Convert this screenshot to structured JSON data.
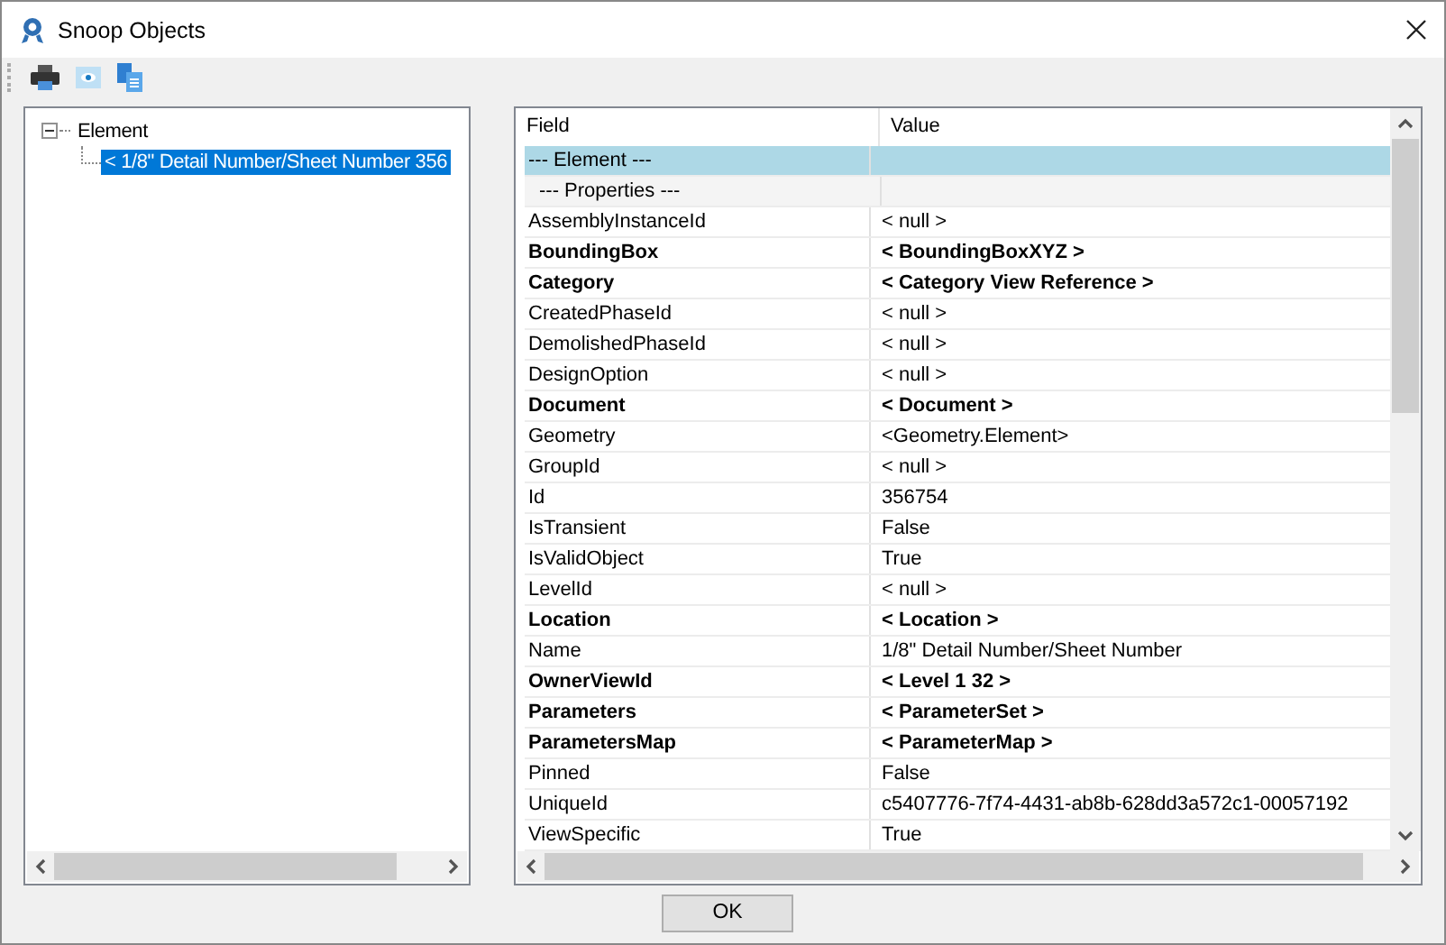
{
  "window": {
    "title": "Snoop Objects"
  },
  "toolbar": [
    {
      "kind": "print"
    },
    {
      "kind": "view"
    },
    {
      "kind": "copy"
    }
  ],
  "tree": {
    "items": [
      {
        "label": "Element",
        "expanded": true,
        "selected": false,
        "children": [
          {
            "label": "< 1/8\" Detail Number/Sheet Number  356",
            "selected": true
          }
        ]
      }
    ]
  },
  "table": {
    "columns": [
      "Field",
      "Value"
    ],
    "rows": [
      {
        "kind": "group",
        "field": "--- Element ---",
        "value": "",
        "selected": true,
        "bold": false
      },
      {
        "kind": "section",
        "field": "--- Properties ---",
        "value": "",
        "selected": false,
        "bold": false
      },
      {
        "kind": "item",
        "field": "AssemblyInstanceId",
        "value": "< null >",
        "selected": false,
        "bold": false
      },
      {
        "kind": "item",
        "field": "BoundingBox",
        "value": "< BoundingBoxXYZ >",
        "selected": false,
        "bold": true
      },
      {
        "kind": "item",
        "field": "Category",
        "value": "< Category  View Reference >",
        "selected": false,
        "bold": true
      },
      {
        "kind": "item",
        "field": "CreatedPhaseId",
        "value": "< null >",
        "selected": false,
        "bold": false
      },
      {
        "kind": "item",
        "field": "DemolishedPhaseId",
        "value": "< null >",
        "selected": false,
        "bold": false
      },
      {
        "kind": "item",
        "field": "DesignOption",
        "value": "< null >",
        "selected": false,
        "bold": false
      },
      {
        "kind": "item",
        "field": "Document",
        "value": "< Document >",
        "selected": false,
        "bold": true
      },
      {
        "kind": "item",
        "field": "Geometry",
        "value": "<Geometry.Element>",
        "selected": false,
        "bold": false
      },
      {
        "kind": "item",
        "field": "GroupId",
        "value": "< null >",
        "selected": false,
        "bold": false
      },
      {
        "kind": "item",
        "field": "Id",
        "value": "356754",
        "selected": false,
        "bold": false
      },
      {
        "kind": "item",
        "field": "IsTransient",
        "value": "False",
        "selected": false,
        "bold": false
      },
      {
        "kind": "item",
        "field": "IsValidObject",
        "value": "True",
        "selected": false,
        "bold": false
      },
      {
        "kind": "item",
        "field": "LevelId",
        "value": "< null >",
        "selected": false,
        "bold": false
      },
      {
        "kind": "item",
        "field": "Location",
        "value": "< Location >",
        "selected": false,
        "bold": true
      },
      {
        "kind": "item",
        "field": "Name",
        "value": "1/8\" Detail Number/Sheet Number",
        "selected": false,
        "bold": false
      },
      {
        "kind": "item",
        "field": "OwnerViewId",
        "value": "< Level 1  32 >",
        "selected": false,
        "bold": true
      },
      {
        "kind": "item",
        "field": "Parameters",
        "value": "< ParameterSet >",
        "selected": false,
        "bold": true
      },
      {
        "kind": "item",
        "field": "ParametersMap",
        "value": "< ParameterMap >",
        "selected": false,
        "bold": true
      },
      {
        "kind": "item",
        "field": "Pinned",
        "value": "False",
        "selected": false,
        "bold": false
      },
      {
        "kind": "item",
        "field": "UniqueId",
        "value": "c5407776-7f74-4431-ab8b-628dd3a572c1-00057192",
        "selected": false,
        "bold": false
      },
      {
        "kind": "item",
        "field": "ViewSpecific",
        "value": "True",
        "selected": false,
        "bold": false
      }
    ]
  },
  "buttons": [
    "OK"
  ]
}
